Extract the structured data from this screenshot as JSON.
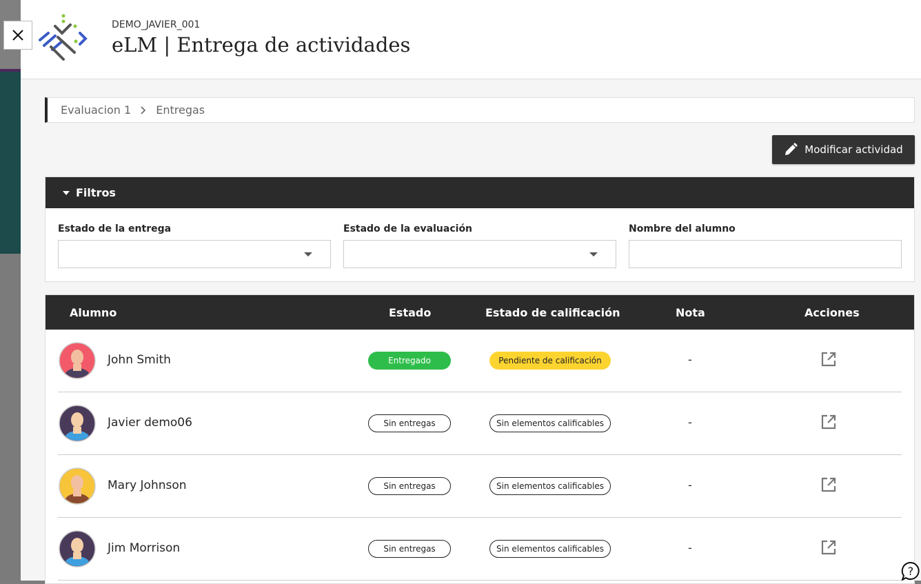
{
  "header": {
    "course_code": "DEMO_JAVIER_001",
    "title": "eLM | Entrega de actividades"
  },
  "breadcrumb": [
    "Evaluacion 1",
    "Entregas"
  ],
  "modify_button": "Modificar actividad",
  "filters": {
    "title": "Filtros",
    "fields": [
      {
        "label": "Estado de la entrega",
        "value": ""
      },
      {
        "label": "Estado de la evaluación",
        "value": ""
      },
      {
        "label": "Nombre del alumno",
        "value": ""
      }
    ]
  },
  "table": {
    "columns": [
      "Alumno",
      "Estado",
      "Estado de calificación",
      "Nota",
      "Acciones"
    ],
    "rows": [
      {
        "name": "John Smith",
        "status": "Entregado",
        "grading": "Pendiente de calificación",
        "grade": "-"
      },
      {
        "name": "Javier demo06",
        "status": "Sin entregas",
        "grading": "Sin elementos calificables",
        "grade": "-"
      },
      {
        "name": "Mary Johnson",
        "status": "Sin entregas",
        "grading": "Sin elementos calificables",
        "grade": "-"
      },
      {
        "name": "Jim Morrison",
        "status": "Sin entregas",
        "grading": "Sin elementos calificables",
        "grade": "-"
      }
    ]
  },
  "colors": {
    "header_dark": "#2b2b2b",
    "delivered": "#2ebd4a",
    "pending": "#fcd430",
    "logo_blue": "#3a5bc7",
    "logo_green": "#8cc63f"
  },
  "icons": [
    "close-icon",
    "pencil-icon",
    "caret-down-icon",
    "chevron-right-icon",
    "open-external-icon",
    "help-icon"
  ]
}
